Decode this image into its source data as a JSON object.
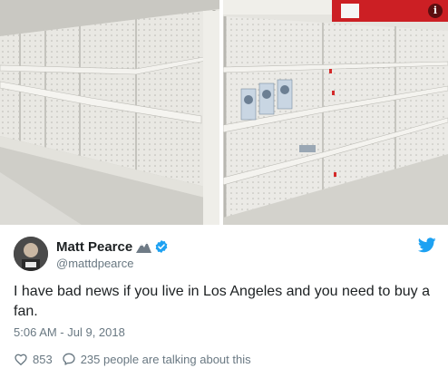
{
  "photos": {
    "info_label": "i"
  },
  "author": {
    "display_name": "Matt Pearce",
    "handle": "@mattdpearce",
    "emoji": "mountain-eagle-emoji",
    "verified": true
  },
  "tweet": {
    "text": "I have bad news if you live in Los Angeles and you need to buy a fan.",
    "timestamp": "5:06 AM - Jul 9, 2018"
  },
  "actions": {
    "likes": "853",
    "replies": "235 people are talking about this"
  },
  "colors": {
    "twitter_blue": "#1da1f2",
    "verified_blue": "#1da1f2",
    "like_red": "#e0245e",
    "muted_text": "#697882"
  }
}
